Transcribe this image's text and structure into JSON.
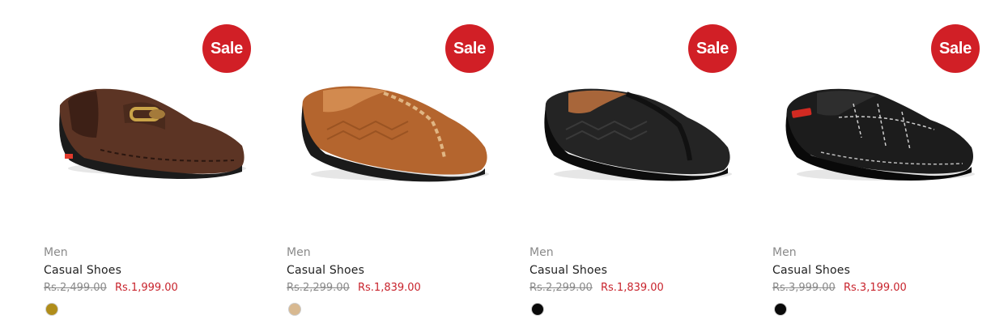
{
  "products": [
    {
      "badge": "Sale",
      "image_icon": "brown-loafer-shoe-icon",
      "category": "Men",
      "title": "Casual Shoes",
      "old_price": "Rs.2,499.00",
      "new_price": "Rs.1,999.00",
      "swatch_color": "#b08d1a"
    },
    {
      "badge": "Sale",
      "image_icon": "tan-loafer-shoe-icon",
      "category": "Men",
      "title": "Casual Shoes",
      "old_price": "Rs.2,299.00",
      "new_price": "Rs.1,839.00",
      "swatch_color": "#d8b991"
    },
    {
      "badge": "Sale",
      "image_icon": "black-loafer-shoe-icon",
      "category": "Men",
      "title": "Casual Shoes",
      "old_price": "Rs.2,299.00",
      "new_price": "Rs.1,839.00",
      "swatch_color": "#0a0a0a"
    },
    {
      "badge": "Sale",
      "image_icon": "black-suede-loafer-shoe-icon",
      "category": "Men",
      "title": "Casual Shoes",
      "old_price": "Rs.3,999.00",
      "new_price": "Rs.3,199.00",
      "swatch_color": "#0a0a0a"
    }
  ],
  "colors": {
    "sale_badge": "#d11f26",
    "sale_price": "#c8232c",
    "muted_text": "#8a8a8a"
  }
}
